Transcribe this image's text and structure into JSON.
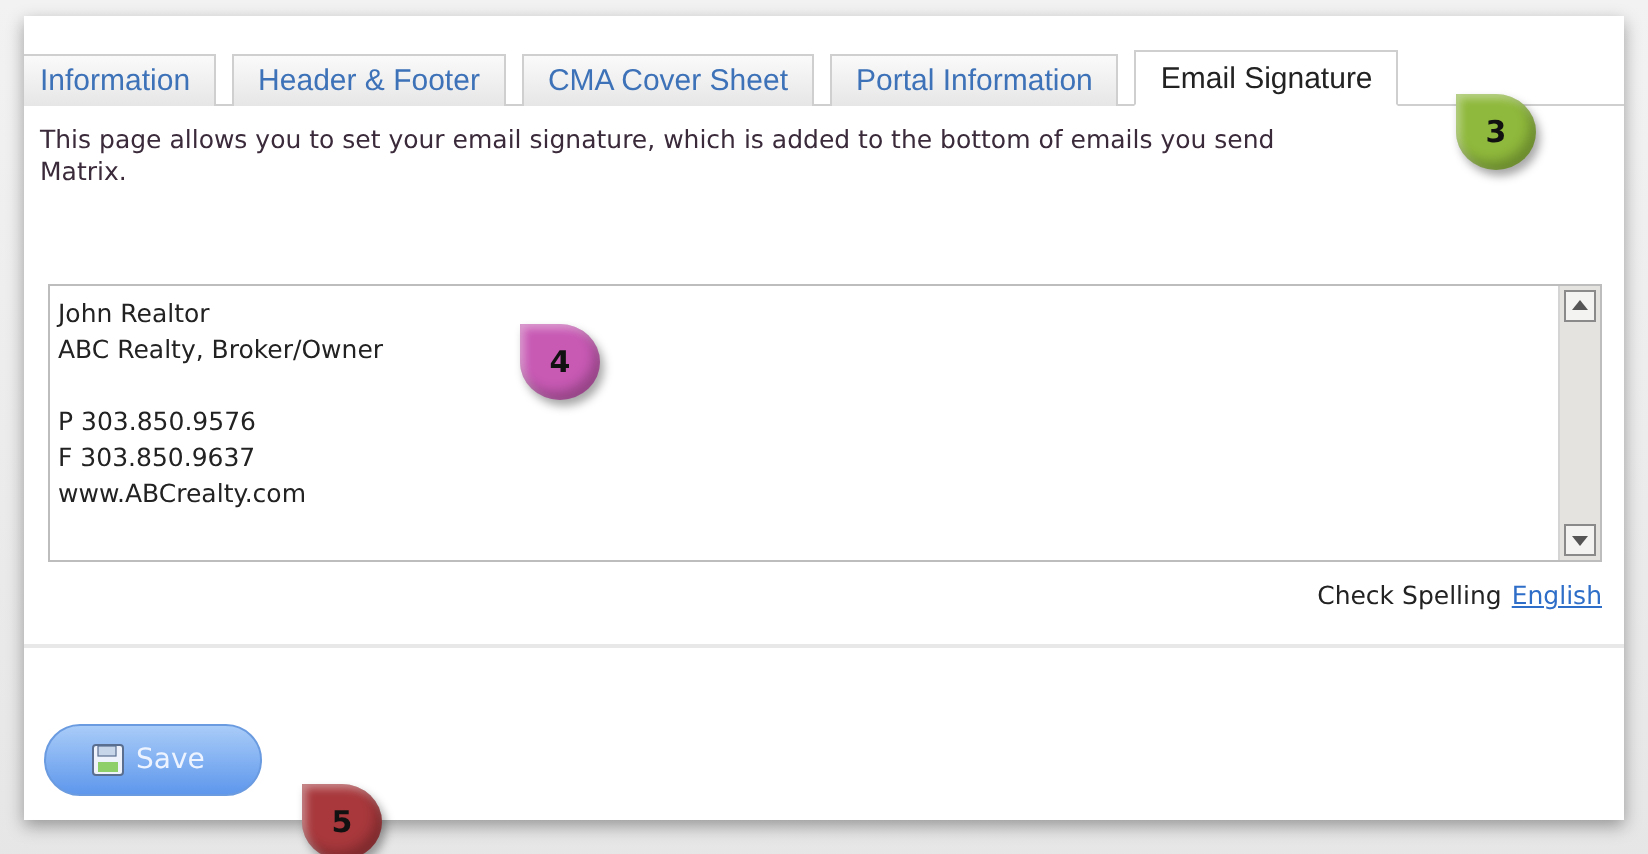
{
  "tabs": {
    "items": [
      {
        "label": "Information",
        "selected": false
      },
      {
        "label": "Header & Footer",
        "selected": false
      },
      {
        "label": "CMA Cover Sheet",
        "selected": false
      },
      {
        "label": "Portal Information",
        "selected": false
      },
      {
        "label": "Email Signature",
        "selected": true
      }
    ],
    "callout": {
      "label": "3",
      "color": "#8fb93c"
    }
  },
  "description_lines": [
    "This page allows you to set your email signature, which is added to the bottom of emails you send",
    "Matrix."
  ],
  "signature": {
    "value": "John Realtor\nABC Realty, Broker/Owner\n\nP 303.850.9576\nF 303.850.9637\nwww.ABCrealty.com",
    "callout": {
      "label": "4",
      "color": "#c85ab4"
    }
  },
  "spelling": {
    "label": "Check Spelling",
    "language": "English"
  },
  "save_button": {
    "label": "Save",
    "callout": {
      "label": "5",
      "color": "#a8383c"
    }
  }
}
